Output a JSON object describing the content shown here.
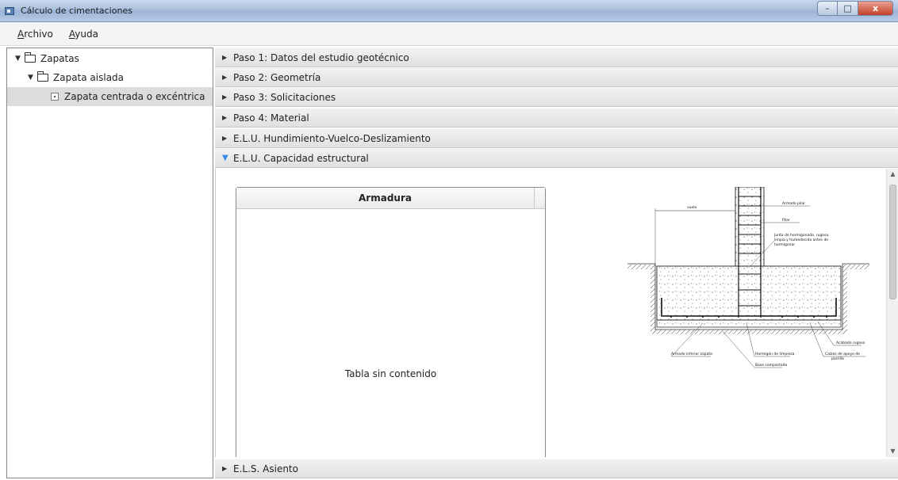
{
  "window": {
    "title": "Cálculo de cimentaciones",
    "buttons": {
      "minimize": "–",
      "maximize": "□",
      "close": "x"
    }
  },
  "menu": {
    "items": [
      {
        "label": "Archivo",
        "mnemonic": "A",
        "rest": "rchivo"
      },
      {
        "label": "Ayuda",
        "mnemonic": "A",
        "rest": "yuda"
      }
    ]
  },
  "tree": {
    "items": [
      {
        "label": "Zapatas",
        "icon": "folder-open-icon",
        "expanded": true
      },
      {
        "label": "Zapata aislada",
        "icon": "folder-open-icon",
        "expanded": true
      },
      {
        "label": "Zapata centrada o excéntrica",
        "icon": "document-icon",
        "selected": true
      }
    ]
  },
  "accordion": {
    "panes": [
      {
        "label": "Paso 1: Datos del estudio geotécnico",
        "expanded": false
      },
      {
        "label": "Paso 2: Geometría",
        "expanded": false
      },
      {
        "label": "Paso 3: Solicitaciones",
        "expanded": false
      },
      {
        "label": "Paso 4: Material",
        "expanded": false
      },
      {
        "label": "E.L.U. Hundimiento-Vuelco-Deslizamiento",
        "expanded": false
      },
      {
        "label": "E.L.U. Capacidad estructural",
        "expanded": true
      },
      {
        "label": "E.L.S. Asiento",
        "expanded": false
      }
    ]
  },
  "armadura_table": {
    "header": "Armadura",
    "empty_text": "Tabla sin contenido"
  },
  "drawing": {
    "labels": {
      "vuelo": "vuelo",
      "armado_pilar": "Armado pilar",
      "pilar": "Pilar",
      "junta_1": "Junta de hormigonado, rugosa,",
      "junta_2": "limpia y humedecida antes de",
      "junta_3": "hormigonar",
      "acabado": "Acabado rugoso",
      "armado_zapata": "Armado inferior zapata",
      "hormigon_limpieza": "Hormigón de limpieza",
      "calzos_1": "Calzos de apoyo de",
      "calzos_2": "parrilla",
      "base": "Base compactada"
    }
  },
  "colors": {
    "selection": "#dcdcdc",
    "expanded_arrow": "#3a8ee6",
    "titlebar": "#a9bfdc"
  }
}
